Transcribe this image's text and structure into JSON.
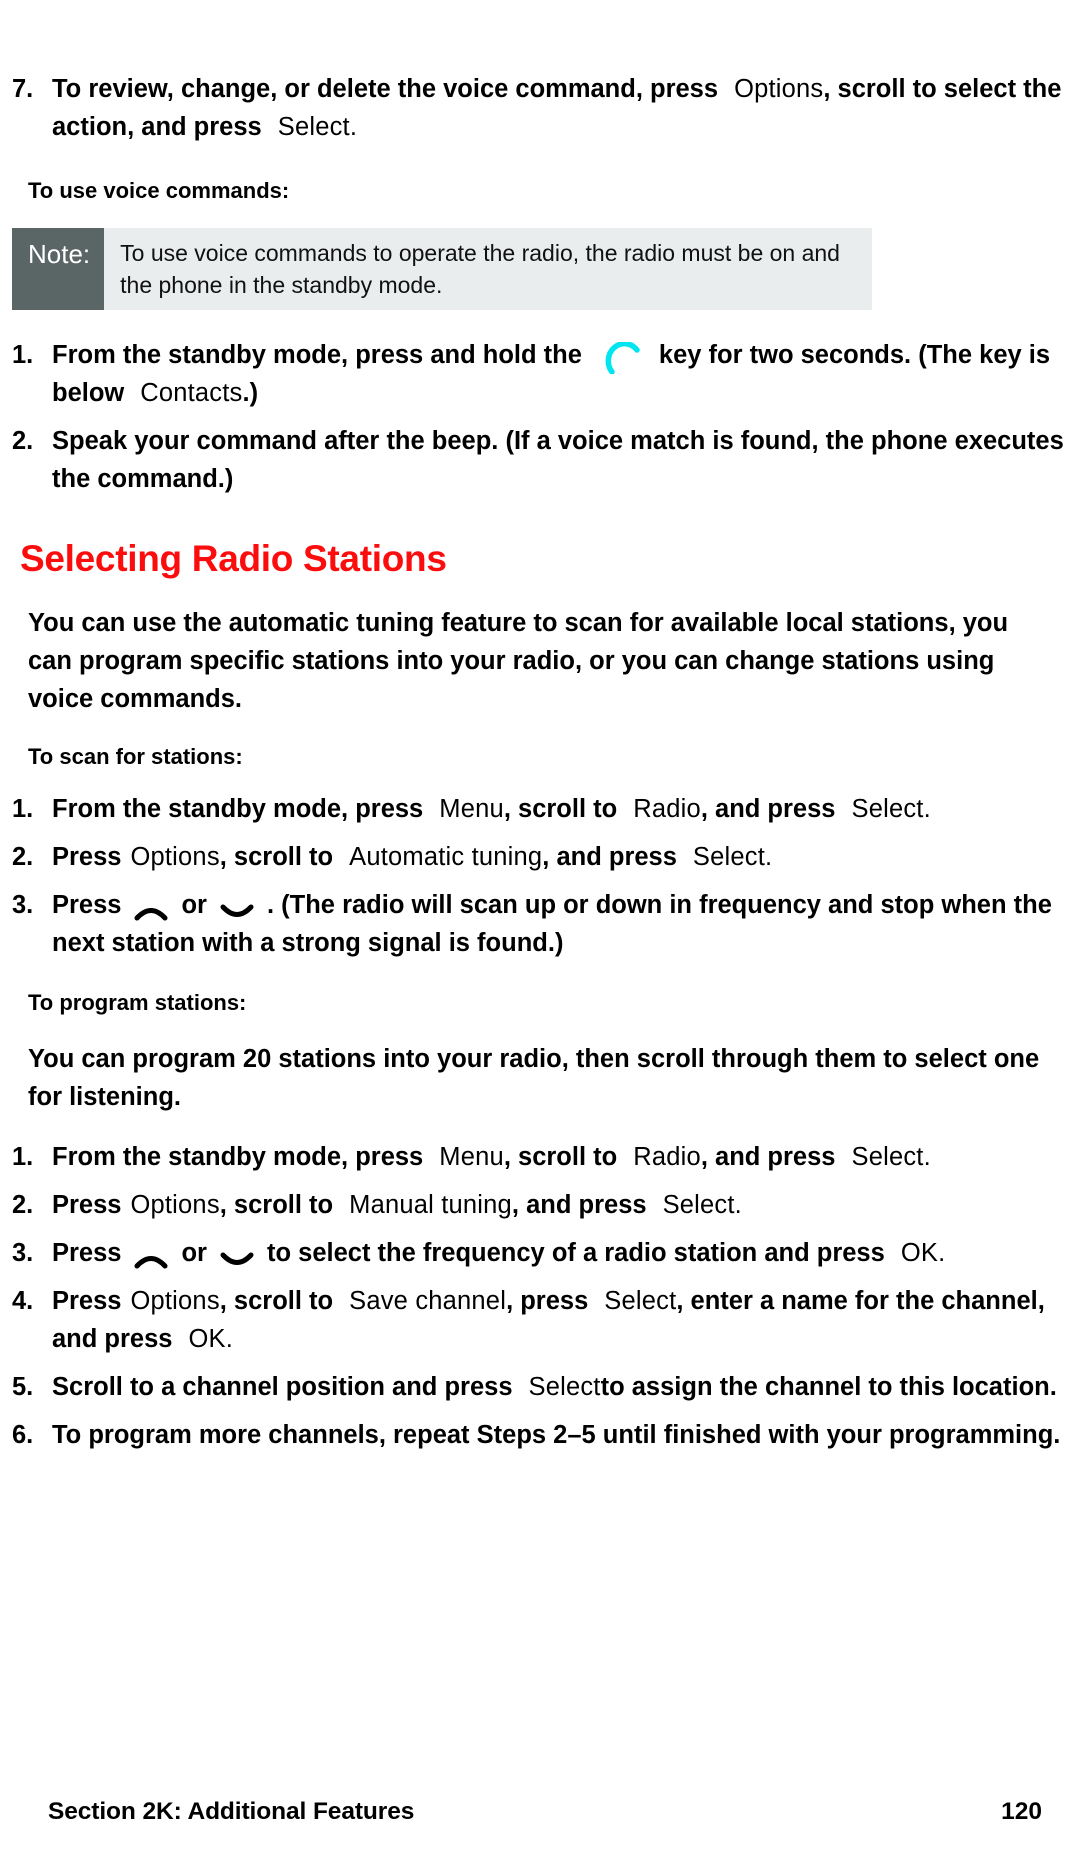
{
  "page": {
    "number": "120",
    "section_label": "Section 2K: Additional Features",
    "heading_color": "#fb0d0d",
    "note_label_bg": "#5a6566",
    "note_body_bg": "#e9edee",
    "icon_color": "#00e5f0"
  },
  "voice_command_step7": {
    "number": "7.",
    "part1": "To review, change, or delete the voice command, press",
    "softkey1": "Options",
    "part2": ", scroll to select the action, and press",
    "softkey2": "Select",
    "part3": "."
  },
  "subheads": {
    "use_voice_commands": "To use voice commands:",
    "scan_for_stations": "To scan for stations:",
    "program_stations": "To program stations:"
  },
  "note": {
    "label": "Note:",
    "text": "To use voice commands to operate the radio, the radio must be on and the phone in the standby mode."
  },
  "voice_steps": [
    {
      "number": "1.",
      "part1": "From the standby mode, press and hold the",
      "icon": "talk-key-icon",
      "part2": "key for two seconds. (The key is below",
      "softkey": "Contacts",
      "part3": ".)"
    },
    {
      "number": "2.",
      "part1": "Speak your command after the beep. (If a voice match is found, the phone executes the command.)"
    }
  ],
  "radio_section": {
    "heading": "Selecting Radio Stations",
    "intro": "You can use the automatic tuning feature to scan for available local stations, you can program specific stations into your radio, or you can change stations using voice commands.",
    "program_intro": "You can program 20 stations into your radio, then scroll through them to select one for listening."
  },
  "scan_steps": [
    {
      "number": "1.",
      "part1": "From the standby mode, press",
      "softkey1": "Menu",
      "part2": ", scroll to",
      "softkey2": "Radio",
      "part3": ", and press",
      "softkey3": "Select",
      "part4": "."
    },
    {
      "number": "2.",
      "part1": "Press",
      "softkey1": "Options",
      "part2": ", scroll to",
      "softkey2": "Automatic tuning",
      "part3": ", and press",
      "softkey3": "Select",
      "part4": "."
    },
    {
      "number": "3.",
      "part1": "Press",
      "icon_up": "nav-up-icon",
      "mid": "or",
      "icon_down": "nav-down-icon",
      "part2": ". (The radio will scan up or down in frequency and stop when the next station with a strong signal is found.)"
    }
  ],
  "program_steps": [
    {
      "number": "1.",
      "part1": "From the standby mode, press",
      "softkey1": "Menu",
      "part2": ", scroll to",
      "softkey2": "Radio",
      "part3": ", and press",
      "softkey3": "Select",
      "part4": "."
    },
    {
      "number": "2.",
      "part1": "Press",
      "softkey1": "Options",
      "part2": ", scroll to",
      "softkey2": "Manual tuning",
      "part3": ", and press",
      "softkey3": "Select",
      "part4": "."
    },
    {
      "number": "3.",
      "part1": "Press",
      "icon_up": "nav-up-icon",
      "mid": "or",
      "icon_down": "nav-down-icon",
      "part2": "to select the frequency of a radio station and press",
      "softkey1": "OK",
      "part3": "."
    },
    {
      "number": "4.",
      "part1": "Press",
      "softkey1": "Options",
      "part2": ", scroll to",
      "softkey2": "Save channel",
      "part3": ", press",
      "softkey3": "Select",
      "part4": ", enter a name for the channel, and press",
      "softkey4": "OK",
      "part5": "."
    },
    {
      "number": "5.",
      "part1": "Scroll to a channel position and press",
      "softkey1": "Select",
      "part2": "to assign the channel to this location."
    },
    {
      "number": "6.",
      "part1": "To program more channels, repeat Steps 2",
      "dash": "–",
      "part2": "5 until finished with your programming."
    }
  ]
}
